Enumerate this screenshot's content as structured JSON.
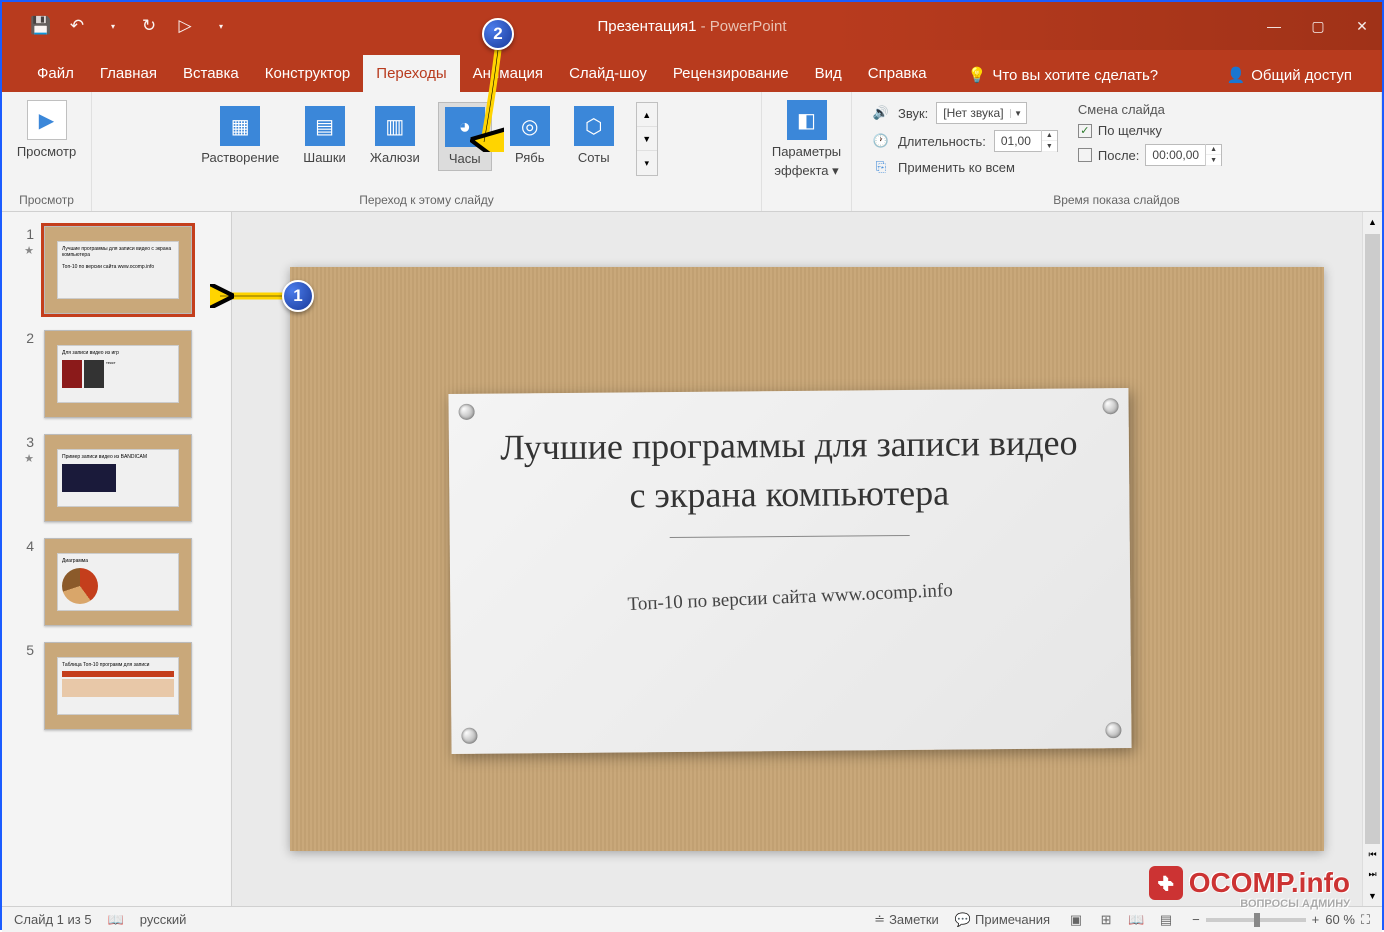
{
  "title": {
    "doc": "Презентация1",
    "sep": " - ",
    "app": "PowerPoint"
  },
  "qat": {
    "save": "💾",
    "undo": "↶",
    "redo": "↻",
    "start": "▷",
    "more": "▾"
  },
  "win": {
    "min": "—",
    "max": "▢",
    "close": "✕"
  },
  "tabs": [
    "Файл",
    "Главная",
    "Вставка",
    "Конструктор",
    "Переходы",
    "Анимация",
    "Слайд-шоу",
    "Рецензирование",
    "Вид",
    "Справка"
  ],
  "active_tab": 4,
  "tell_me": {
    "icon": "💡",
    "text": "Что вы хотите сделать?"
  },
  "share": {
    "icon": "👤",
    "text": "Общий доступ"
  },
  "ribbon": {
    "preview": {
      "label": "Просмотр",
      "group": "Просмотр"
    },
    "transitions": [
      {
        "name": "Растворение"
      },
      {
        "name": "Шашки"
      },
      {
        "name": "Жалюзи"
      },
      {
        "name": "Часы",
        "active": true
      },
      {
        "name": "Рябь"
      },
      {
        "name": "Соты"
      }
    ],
    "trans_group": "Переход к этому слайду",
    "effect_opts": {
      "line1": "Параметры",
      "line2": "эффекта"
    },
    "timing": {
      "sound": {
        "label": "Звук:",
        "value": "[Нет звука]"
      },
      "duration": {
        "label": "Длительность:",
        "value": "01,00"
      },
      "apply_all": "Применить ко всем"
    },
    "advance": {
      "title": "Смена слайда",
      "on_click": {
        "checked": true,
        "label": "По щелчку"
      },
      "after": {
        "checked": false,
        "label": "После:",
        "value": "00:00,00"
      }
    },
    "timing_group": "Время показа слайдов"
  },
  "thumbs": [
    {
      "n": "1",
      "star": true,
      "title": "Лучшие программы для записи видео с экрана компьютера",
      "sub": "Топ-10 по версии сайта www.ocomp.info",
      "selected": true
    },
    {
      "n": "2",
      "star": false,
      "title": "Для записи видео из игр"
    },
    {
      "n": "3",
      "star": true,
      "title": "Пример записи видео из BANDICAM"
    },
    {
      "n": "4",
      "star": false,
      "title": "Диаграмма"
    },
    {
      "n": "5",
      "star": false,
      "title": "Таблица Топ-10 программ для записи"
    }
  ],
  "slide": {
    "title": "Лучшие программы для записи видео с экрана компьютера",
    "subtitle": "Топ-10 по версии сайта www.ocomp.info"
  },
  "status": {
    "slide_pos": "Слайд 1 из 5",
    "lang": "русский",
    "notes": "Заметки",
    "comments": "Примечания",
    "zoom": "60 %"
  },
  "annotations": {
    "1": "1",
    "2": "2"
  },
  "watermark": {
    "text": "OCOMP.info",
    "sub": "ВОПРОСЫ АДМИНУ"
  }
}
